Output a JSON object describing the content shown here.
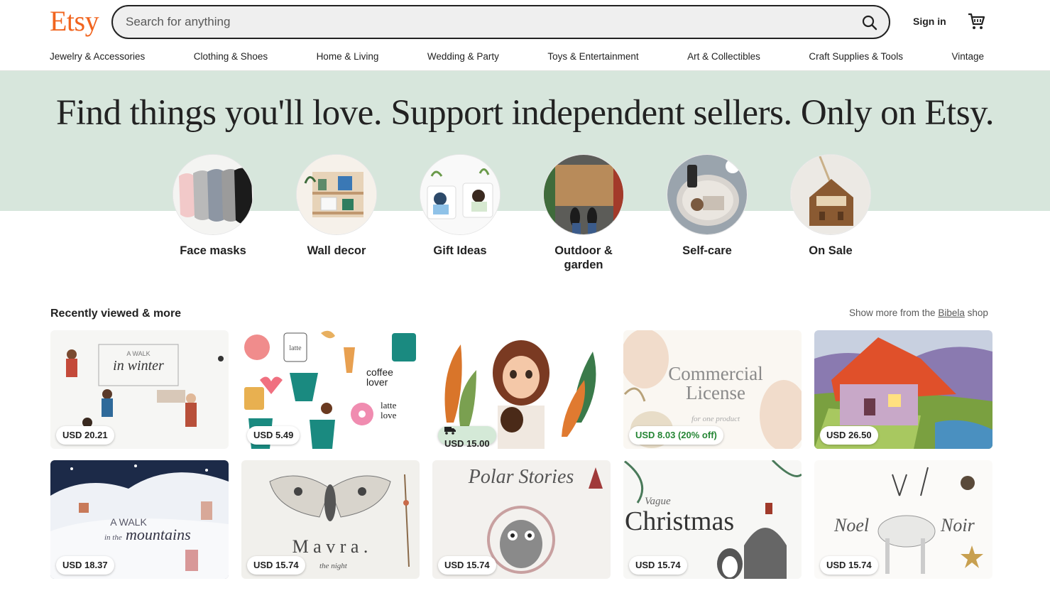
{
  "header": {
    "logo": "Etsy",
    "search_placeholder": "Search for anything",
    "signin": "Sign in"
  },
  "categories": [
    "Jewelry & Accessories",
    "Clothing & Shoes",
    "Home & Living",
    "Wedding & Party",
    "Toys & Entertainment",
    "Art & Collectibles",
    "Craft Supplies & Tools",
    "Vintage"
  ],
  "hero": {
    "title": "Find things you'll love. Support independent sellers. Only on Etsy."
  },
  "circles": [
    {
      "label": "Face masks"
    },
    {
      "label": "Wall decor"
    },
    {
      "label": "Gift Ideas"
    },
    {
      "label": "Outdoor & garden"
    },
    {
      "label": "Self-care"
    },
    {
      "label": "On Sale"
    }
  ],
  "recently_viewed": {
    "title": "Recently viewed & more",
    "more_prefix": "Show more from the",
    "shop_name": "Bibela",
    "more_suffix": "shop"
  },
  "products": [
    {
      "price": "USD 20.21"
    },
    {
      "price": "USD 5.49"
    },
    {
      "price": "USD 15.00"
    },
    {
      "price": "USD 8.03 (20% off)"
    },
    {
      "price": "USD 26.50"
    },
    {
      "price": "USD 18.37"
    },
    {
      "price": "USD 15.74"
    },
    {
      "price": "USD 15.74"
    },
    {
      "price": "USD 15.74"
    },
    {
      "price": "USD 15.74"
    }
  ],
  "product_art_text": {
    "p0": [
      "A WALK",
      "in winter"
    ],
    "p1": [
      "latte",
      "coffee",
      "lover",
      "latte",
      "love"
    ],
    "p3": [
      "Commercial",
      "License",
      "for one product"
    ],
    "p5": [
      "A WALK",
      "in the",
      "mountains"
    ],
    "p6": [
      "M a v r a .",
      "the night"
    ],
    "p7": [
      "Polar Stories"
    ],
    "p8": [
      "Vague",
      "Christmas"
    ],
    "p9": [
      "Noel",
      "Noir"
    ]
  },
  "colors": {
    "brand": "#f1641e",
    "hero_bg": "#d7e6dc",
    "sale_green": "#258635"
  }
}
